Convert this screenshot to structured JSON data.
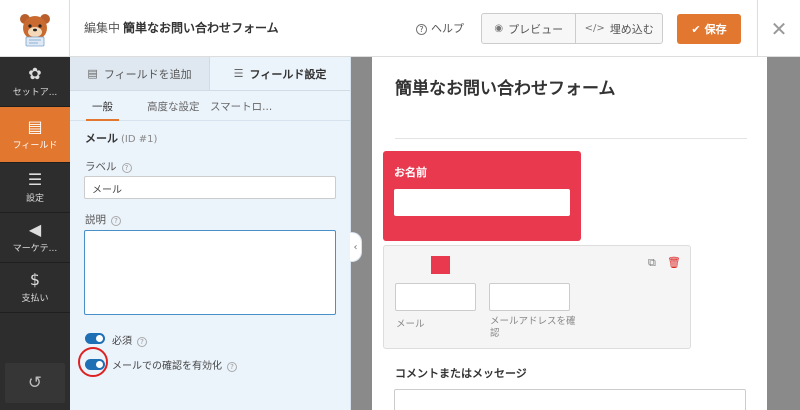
{
  "topbar": {
    "editing_prefix": "編集中",
    "form_name": "簡単なお問い合わせフォーム",
    "help_label": "ヘルプ",
    "preview_label": "プレビュー",
    "embed_label": "埋め込む",
    "save_label": "保存"
  },
  "nav": {
    "items": [
      {
        "label": "セットア...",
        "icon": "gear-icon"
      },
      {
        "label": "フィールド",
        "icon": "fields-icon",
        "active": true
      },
      {
        "label": "設定",
        "icon": "sliders-icon"
      },
      {
        "label": "マーケテ...",
        "icon": "megaphone-icon"
      },
      {
        "label": "支払い",
        "icon": "dollar-icon"
      }
    ]
  },
  "panel": {
    "tab_add": "フィールドを追加",
    "tab_settings": "フィールド設定",
    "subtabs": [
      "一般",
      "高度な設定",
      "スマートロ..."
    ],
    "field_title": "メール",
    "field_id": "(ID #1)",
    "label_label": "ラベル",
    "label_value": "メール",
    "desc_label": "説明",
    "toggle_required": "必須",
    "toggle_confirm": "メールでの確認を有効化"
  },
  "preview": {
    "form_title": "簡単なお問い合わせフォーム",
    "name_label": "お名前",
    "email_sub1": "メール",
    "email_sub2": "メールアドレスを確認",
    "comment_label": "コメントまたはメッセージ"
  },
  "colors": {
    "accent": "#e27730",
    "highlight_red": "#e8394f",
    "toggle_blue": "#1f6fb5",
    "nav_bg": "#2d2d2d",
    "panel_bg": "#ebf3fb"
  }
}
